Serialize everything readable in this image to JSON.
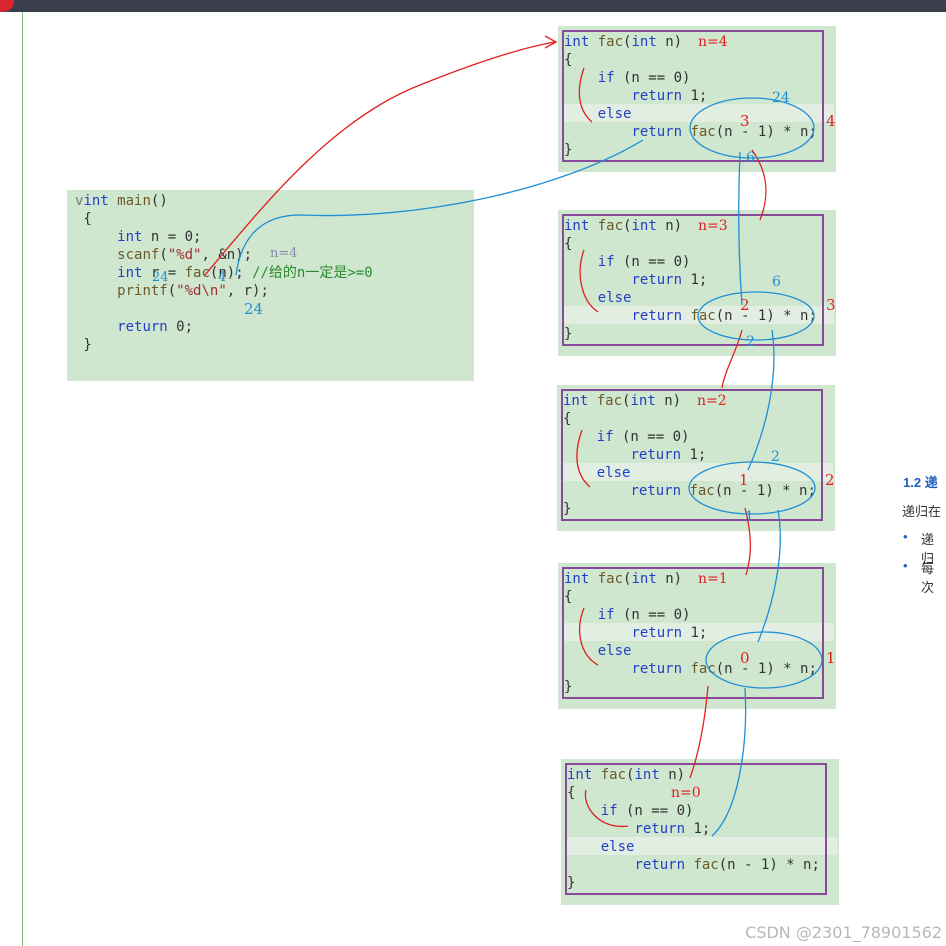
{
  "main": {
    "lines": [
      "int main()",
      "{",
      "",
      "    int n = 0;",
      "    scanf(\"%d\", &n);",
      "    int r = fac(n); //给的n一定是>=0",
      "    printf(\"%d\\n\", r);",
      "",
      "    return 0;",
      "}"
    ],
    "annotations": {
      "n_value": "n=4",
      "arg": "4",
      "result_r": "24",
      "result_print": "24"
    }
  },
  "frames": [
    {
      "lines": [
        "int fac(int n)",
        "{",
        "    if (n == 0)",
        "        return 1;",
        "    else",
        "        return fac(n - 1) * n;",
        "}"
      ],
      "n_label": "n=4",
      "arg_value": "3",
      "mul_value": "4",
      "ret_value": "6",
      "result": "24"
    },
    {
      "lines": [
        "int fac(int n)",
        "{",
        "    if (n == 0)",
        "        return 1;",
        "    else",
        "        return fac(n - 1) * n;",
        "}"
      ],
      "n_label": "n=3",
      "arg_value": "2",
      "mul_value": "3",
      "ret_value": "2",
      "result": "6"
    },
    {
      "lines": [
        "int fac(int n)",
        "{",
        "    if (n == 0)",
        "        return 1;",
        "    else",
        "        return fac(n - 1) * n;",
        "}"
      ],
      "n_label": "n=2",
      "arg_value": "1",
      "mul_value": "2",
      "ret_value": "1",
      "result": "2"
    },
    {
      "lines": [
        "int fac(int n)",
        "{",
        "    if (n == 0)",
        "        return 1;",
        "    else",
        "        return fac(n - 1) * n;",
        "}"
      ],
      "n_label": "n=1",
      "arg_value": "0",
      "mul_value": "1",
      "ret_value": "",
      "result": ""
    },
    {
      "lines": [
        "int fac(int n)",
        "{",
        "    if (n == 0)",
        "        return 1;",
        "    else",
        "        return fac(n - 1) * n;",
        "}"
      ],
      "n_label": "n=0",
      "arg_value": "",
      "mul_value": "",
      "ret_value": "",
      "result": ""
    }
  ],
  "side": {
    "heading_num": "1.2",
    "heading_text": "递",
    "para": "递归在",
    "bullets": [
      "递归",
      "每次"
    ]
  },
  "watermark": "CSDN @2301_78901562",
  "colors": {
    "panel": "#cfe6cf",
    "frame_border": "#8a4a9c",
    "keyword": "#2340c8",
    "annotation_red": "#e02020",
    "annotation_blue": "#1f8fd6"
  }
}
